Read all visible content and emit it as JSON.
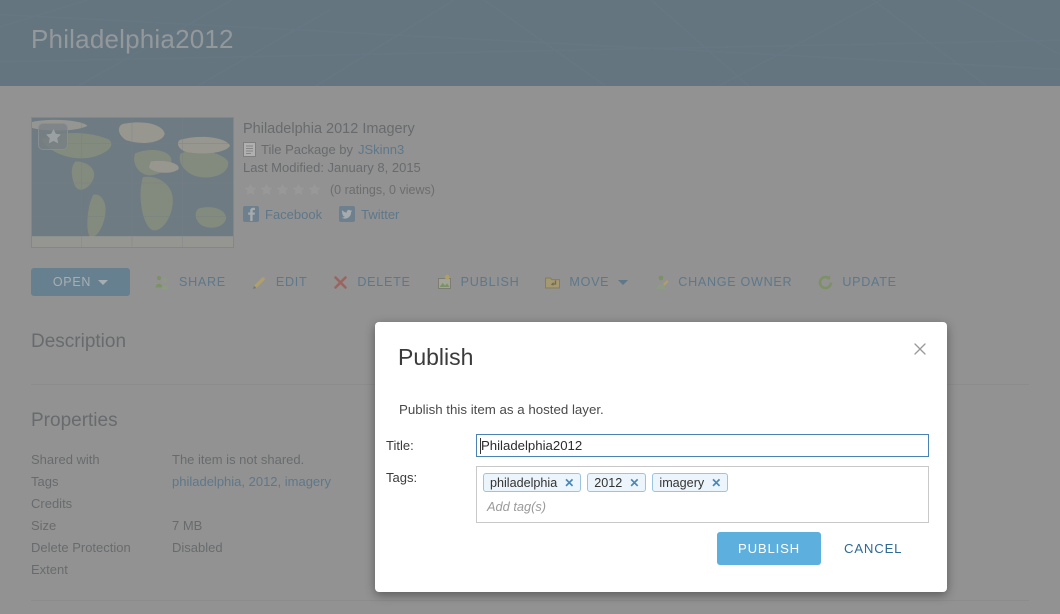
{
  "banner": {
    "title": "Philadelphia2012"
  },
  "item": {
    "title": "Philadelphia 2012 Imagery",
    "type_prefix": "Tile Package by",
    "owner": "JSkinn3",
    "last_modified": "Last Modified: January 8, 2015",
    "ratings_text": "(0 ratings, 0 views)",
    "stars": 5,
    "social": [
      {
        "name": "facebook",
        "label": "Facebook"
      },
      {
        "name": "twitter",
        "label": "Twitter"
      }
    ]
  },
  "toolbar": {
    "open_label": "OPEN",
    "items": [
      {
        "icon": "share-icon",
        "label": "SHARE",
        "caret": false
      },
      {
        "icon": "edit-pencil-icon",
        "label": "EDIT",
        "caret": false
      },
      {
        "icon": "delete-x-icon",
        "label": "DELETE",
        "caret": false
      },
      {
        "icon": "publish-icon",
        "label": "PUBLISH",
        "caret": false
      },
      {
        "icon": "move-folder-icon",
        "label": "MOVE",
        "caret": true
      },
      {
        "icon": "change-owner-icon",
        "label": "CHANGE OWNER",
        "caret": false
      },
      {
        "icon": "update-refresh-icon",
        "label": "UPDATE",
        "caret": false
      }
    ]
  },
  "sections": {
    "description_heading": "Description",
    "properties_heading": "Properties"
  },
  "properties": [
    {
      "key": "Shared with",
      "value": "The item is not shared.",
      "is_link": false
    },
    {
      "key": "Tags",
      "value": "philadelphia, 2012, imagery",
      "is_link": true
    },
    {
      "key": "Credits",
      "value": "",
      "is_link": false
    },
    {
      "key": "Size",
      "value": "7 MB",
      "is_link": false
    },
    {
      "key": "Delete Protection",
      "value": "Disabled",
      "is_link": false
    },
    {
      "key": "Extent",
      "value": "",
      "is_link": false
    }
  ],
  "dialog": {
    "title": "Publish",
    "subtitle": "Publish this item as a hosted layer.",
    "close_label": "×",
    "title_field": {
      "label": "Title:",
      "value": "Philadelphia2012"
    },
    "tags_field": {
      "label": "Tags:",
      "placeholder": "Add tag(s)",
      "chips": [
        {
          "label": "philadelphia",
          "remove": "✕"
        },
        {
          "label": "2012",
          "remove": "✕"
        },
        {
          "label": "imagery",
          "remove": "✕"
        }
      ]
    },
    "publish_label": "PUBLISH",
    "cancel_label": "CANCEL"
  },
  "colors": {
    "banner": "#2b5f82",
    "page_bg": "#a5a5a5",
    "link": "#3a6e92",
    "primary_button": "#5dafdd",
    "open_button": "#4b7f9f",
    "chip_bg": "#ecf5fb",
    "chip_border": "#9cc4dd"
  }
}
